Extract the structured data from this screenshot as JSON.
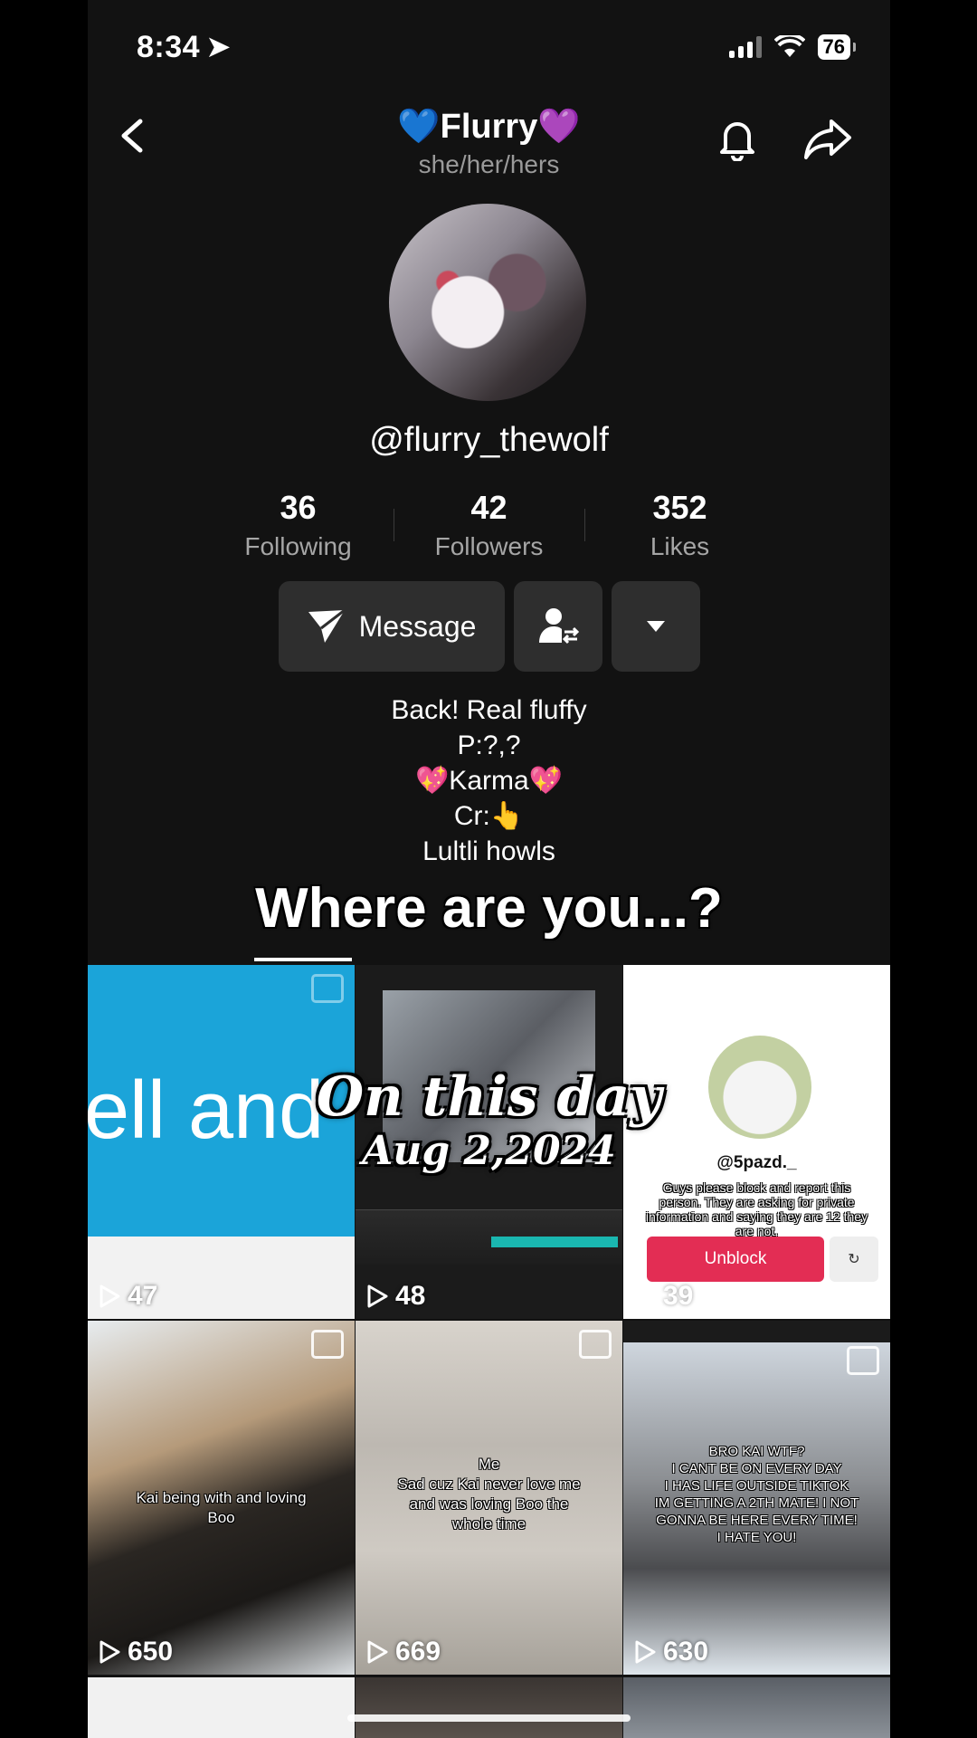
{
  "status_bar": {
    "time": "8:34",
    "battery": "76"
  },
  "profile": {
    "display_name": "Flurry",
    "name_emoji_left": "💙",
    "name_emoji_right": "💜",
    "pronouns": "she/her/hers",
    "handle": "@flurry_thewolf"
  },
  "stats": [
    {
      "value": "36",
      "label": "Following"
    },
    {
      "value": "42",
      "label": "Followers"
    },
    {
      "value": "352",
      "label": "Likes"
    }
  ],
  "actions": {
    "message_label": "Message"
  },
  "bio": [
    "Back! Real fluffy",
    "P:?,?",
    "💖Karma💖",
    "Cr:👆",
    "Lultli howls"
  ],
  "caption": "Where are you...?",
  "on_this_day": {
    "line1": "On this day",
    "line2": "Aug 2,2024"
  },
  "videos": [
    {
      "views": "47",
      "text": "ell and"
    },
    {
      "views": "48",
      "text": ""
    },
    {
      "views": "39",
      "username": "@5pazd._",
      "overlay": "Guys please block and report this person. They are asking for private information and saying they are 12 they are not.",
      "button": "Unblock"
    },
    {
      "views": "650",
      "overlay": "Kai being with and loving Boo"
    },
    {
      "views": "669",
      "overlay": "Me\nSad cuz Kai never love me and was loving Boo the whole time"
    },
    {
      "views": "630",
      "overlay": "BRO KAI WTF?\nI CANT BE ON EVERY DAY\nI HAS LIFE OUTSIDE TIKTOK\nIM GETTING A 2TH MATE! I NOT GONNA BE HERE EVERY TIME!\nI HATE YOU!"
    }
  ],
  "icons": [
    "back-icon",
    "bell-icon",
    "share-icon",
    "send-icon",
    "friends-icon",
    "dropdown-icon",
    "play-icon",
    "photo-icon"
  ]
}
